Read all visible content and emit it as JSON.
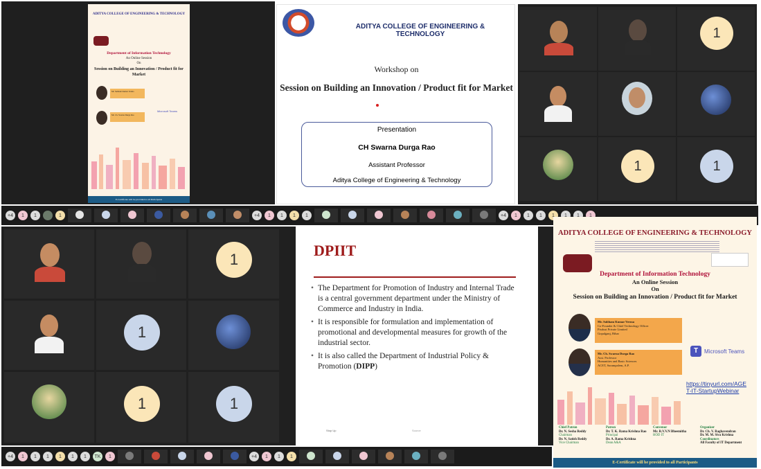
{
  "poster_small": {
    "college": "ADITYA COLLEGE OF ENGINEERING & TECHNOLOGY",
    "dept": "Department of Information Technology",
    "online": "An Online Session",
    "on": "On",
    "title": "Session on Building an Innovation / Product fit for Market",
    "teams": "Microsoft Teams",
    "speaker1": "Mr. Subham Kumar Verma",
    "speaker2": "Mr. Ch. Swarna Durga Rao",
    "footer": "E-Certificate will be provided to all Participants"
  },
  "slide_workshop": {
    "college": "ADITYA COLLEGE OF ENGINEERING & TECHNOLOGY",
    "workshop_on": "Workshop on",
    "title": "Session on Building an Innovation / Product fit for Market",
    "presentation": "Presentation",
    "presenter": "CH Swarna Durga Rao",
    "role": "Assistant Professor",
    "org": "Aditya College of Engineering & Technology"
  },
  "slide_dpiit": {
    "heading": "DPIIT",
    "bullet1": "The Department for Promotion of Industry and Internal Trade is a central government department under the Ministry of Commerce and Industry in India.",
    "bullet2": "It is responsible for formulation and implementation of promotional and developmental measures for growth of the industrial sector.",
    "bullet3_pre": "It is also called the Department of Industrial Policy & Promotion (",
    "bullet3_bold": "DIPP",
    "bullet3_post": ")"
  },
  "poster_large": {
    "college": "ADITYA COLLEGE OF ENGINEERING & TECHNOLOGY",
    "dept": "Department of Information Technology",
    "online": "An Online Session",
    "on": "On",
    "title": "Session on Building an Innovation / Product fit for Market",
    "speaker1_name": "Mr. Subham Kumar Verma",
    "speaker1_role": "Co-Founder & Chief Technology Officer",
    "speaker1_org": "Pixdust Private Limited",
    "speaker1_loc": "Gopalganj, Bihar",
    "speaker2_name": "Mr. Ch. Swarna Durga Rao",
    "speaker2_role": "Asst. Professor",
    "speaker2_dept": "Humanities and Basic Sciences",
    "speaker2_org": "ACET, Surampalem, A.P.",
    "teams": "Microsoft Teams",
    "link": "https://tinyurl.com/AGET-IT-StartupWebinar",
    "chief_patron": "Chief Patron",
    "patron": "Patron",
    "convenor": "Convenor",
    "organizer": "Organizer",
    "cp1": "Dr. N. Sesha Reddy",
    "cp1r": "Chairman",
    "cp2": "Dr. N. Satish Reddy",
    "cp2r": "Vice Chairman",
    "p1": "Dr. T. K. Rama Krishna Rao",
    "p1r": "Principal",
    "p2": "Dr. A. Rama Krishna",
    "p2r": "Dean A&A",
    "cv1": "Mr. R.V.V.N Bheemitha",
    "cv1r": "HOD IT",
    "o1": "Dr. Ch. V. Raghavendran",
    "o2": "Dr. M. M. Siva Krishna",
    "coord": "Coordinators",
    "coord2": "All Faculty of IT Department",
    "footer": "E-Certificate will be provided to all Participants"
  },
  "tiles": {
    "count_badge": "1",
    "stop_label": "Stop Up",
    "footer_label": "Source"
  },
  "strip": {
    "badge_plus": "+4",
    "badge_tk": "TK",
    "badge_one": "1"
  }
}
